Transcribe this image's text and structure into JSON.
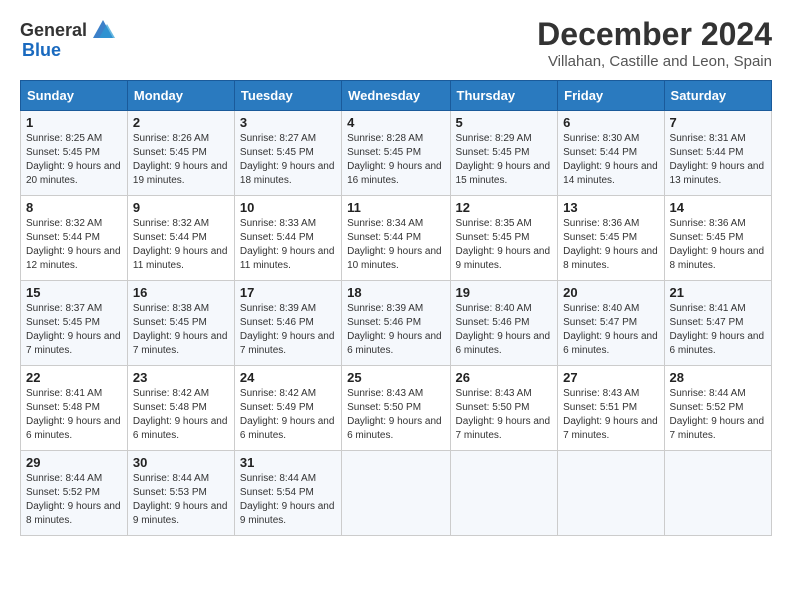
{
  "header": {
    "logo_general": "General",
    "logo_blue": "Blue",
    "title": "December 2024",
    "subtitle": "Villahan, Castille and Leon, Spain"
  },
  "calendar": {
    "days_of_week": [
      "Sunday",
      "Monday",
      "Tuesday",
      "Wednesday",
      "Thursday",
      "Friday",
      "Saturday"
    ],
    "weeks": [
      [
        {
          "day": "1",
          "sunrise": "8:25 AM",
          "sunset": "5:45 PM",
          "daylight": "9 hours and 20 minutes."
        },
        {
          "day": "2",
          "sunrise": "8:26 AM",
          "sunset": "5:45 PM",
          "daylight": "9 hours and 19 minutes."
        },
        {
          "day": "3",
          "sunrise": "8:27 AM",
          "sunset": "5:45 PM",
          "daylight": "9 hours and 18 minutes."
        },
        {
          "day": "4",
          "sunrise": "8:28 AM",
          "sunset": "5:45 PM",
          "daylight": "9 hours and 16 minutes."
        },
        {
          "day": "5",
          "sunrise": "8:29 AM",
          "sunset": "5:45 PM",
          "daylight": "9 hours and 15 minutes."
        },
        {
          "day": "6",
          "sunrise": "8:30 AM",
          "sunset": "5:44 PM",
          "daylight": "9 hours and 14 minutes."
        },
        {
          "day": "7",
          "sunrise": "8:31 AM",
          "sunset": "5:44 PM",
          "daylight": "9 hours and 13 minutes."
        }
      ],
      [
        {
          "day": "8",
          "sunrise": "8:32 AM",
          "sunset": "5:44 PM",
          "daylight": "9 hours and 12 minutes."
        },
        {
          "day": "9",
          "sunrise": "8:32 AM",
          "sunset": "5:44 PM",
          "daylight": "9 hours and 11 minutes."
        },
        {
          "day": "10",
          "sunrise": "8:33 AM",
          "sunset": "5:44 PM",
          "daylight": "9 hours and 11 minutes."
        },
        {
          "day": "11",
          "sunrise": "8:34 AM",
          "sunset": "5:44 PM",
          "daylight": "9 hours and 10 minutes."
        },
        {
          "day": "12",
          "sunrise": "8:35 AM",
          "sunset": "5:45 PM",
          "daylight": "9 hours and 9 minutes."
        },
        {
          "day": "13",
          "sunrise": "8:36 AM",
          "sunset": "5:45 PM",
          "daylight": "9 hours and 8 minutes."
        },
        {
          "day": "14",
          "sunrise": "8:36 AM",
          "sunset": "5:45 PM",
          "daylight": "9 hours and 8 minutes."
        }
      ],
      [
        {
          "day": "15",
          "sunrise": "8:37 AM",
          "sunset": "5:45 PM",
          "daylight": "9 hours and 7 minutes."
        },
        {
          "day": "16",
          "sunrise": "8:38 AM",
          "sunset": "5:45 PM",
          "daylight": "9 hours and 7 minutes."
        },
        {
          "day": "17",
          "sunrise": "8:39 AM",
          "sunset": "5:46 PM",
          "daylight": "9 hours and 7 minutes."
        },
        {
          "day": "18",
          "sunrise": "8:39 AM",
          "sunset": "5:46 PM",
          "daylight": "9 hours and 6 minutes."
        },
        {
          "day": "19",
          "sunrise": "8:40 AM",
          "sunset": "5:46 PM",
          "daylight": "9 hours and 6 minutes."
        },
        {
          "day": "20",
          "sunrise": "8:40 AM",
          "sunset": "5:47 PM",
          "daylight": "9 hours and 6 minutes."
        },
        {
          "day": "21",
          "sunrise": "8:41 AM",
          "sunset": "5:47 PM",
          "daylight": "9 hours and 6 minutes."
        }
      ],
      [
        {
          "day": "22",
          "sunrise": "8:41 AM",
          "sunset": "5:48 PM",
          "daylight": "9 hours and 6 minutes."
        },
        {
          "day": "23",
          "sunrise": "8:42 AM",
          "sunset": "5:48 PM",
          "daylight": "9 hours and 6 minutes."
        },
        {
          "day": "24",
          "sunrise": "8:42 AM",
          "sunset": "5:49 PM",
          "daylight": "9 hours and 6 minutes."
        },
        {
          "day": "25",
          "sunrise": "8:43 AM",
          "sunset": "5:50 PM",
          "daylight": "9 hours and 6 minutes."
        },
        {
          "day": "26",
          "sunrise": "8:43 AM",
          "sunset": "5:50 PM",
          "daylight": "9 hours and 7 minutes."
        },
        {
          "day": "27",
          "sunrise": "8:43 AM",
          "sunset": "5:51 PM",
          "daylight": "9 hours and 7 minutes."
        },
        {
          "day": "28",
          "sunrise": "8:44 AM",
          "sunset": "5:52 PM",
          "daylight": "9 hours and 7 minutes."
        }
      ],
      [
        {
          "day": "29",
          "sunrise": "8:44 AM",
          "sunset": "5:52 PM",
          "daylight": "9 hours and 8 minutes."
        },
        {
          "day": "30",
          "sunrise": "8:44 AM",
          "sunset": "5:53 PM",
          "daylight": "9 hours and 9 minutes."
        },
        {
          "day": "31",
          "sunrise": "8:44 AM",
          "sunset": "5:54 PM",
          "daylight": "9 hours and 9 minutes."
        },
        null,
        null,
        null,
        null
      ]
    ]
  }
}
